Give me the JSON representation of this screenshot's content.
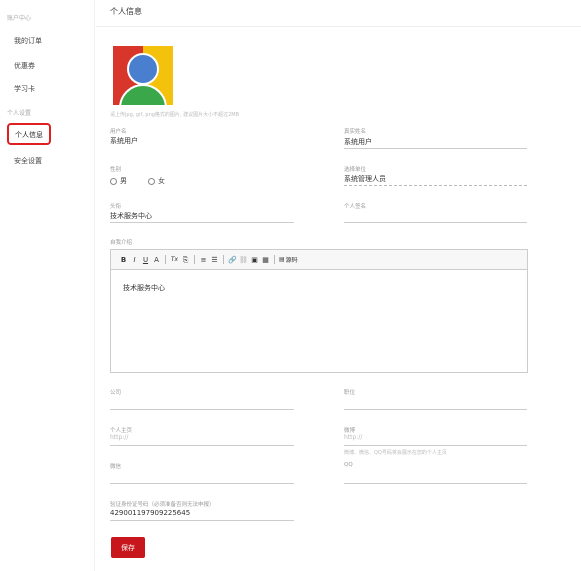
{
  "sidebar": {
    "group1": "账户中心",
    "items1": [
      "我的订单",
      "优惠券",
      "学习卡"
    ],
    "group2": "个人设置",
    "items2": [
      "个人信息",
      "安全设置"
    ]
  },
  "main": {
    "title": "个人信息",
    "avatar_hint": "请上传jpg, gif, png格式的图片, 建议图片大小不超过2MB",
    "username": {
      "label": "用户名",
      "value": "系统用户"
    },
    "realname": {
      "label": "真实姓名",
      "value": "系统用户"
    },
    "gender": {
      "label": "性别",
      "options": [
        "男",
        "女"
      ]
    },
    "unit": {
      "label": "选择单位",
      "value": "系统管理人员"
    },
    "title_field": {
      "label": "头衔",
      "value": "技术服务中心"
    },
    "signature": {
      "label": "个人签名",
      "value": ""
    },
    "intro": {
      "label": "自我介绍",
      "content": "技术服务中心",
      "toolbar": [
        "B",
        "I",
        "U",
        "A",
        "Tx",
        "⎘",
        "≡",
        "☰",
        "🔗",
        "⛓",
        "▣",
        "▦"
      ],
      "source_label": "源码"
    },
    "company": {
      "label": "公司",
      "value": ""
    },
    "position": {
      "label": "职位",
      "value": ""
    },
    "homepage": {
      "label": "个人主页",
      "placeholder": "http://"
    },
    "weibo": {
      "label": "微博",
      "placeholder": "http://"
    },
    "social_hint": "微博、微信、QQ号码将会展示在您的个人主页",
    "wechat": {
      "label": "微信",
      "value": ""
    },
    "qq": {
      "label": "QQ",
      "value": ""
    },
    "idcard": {
      "label": "验证身份证号码（必须准备否则无法申报）",
      "value": "429001197909225645"
    },
    "save_label": "保存"
  }
}
